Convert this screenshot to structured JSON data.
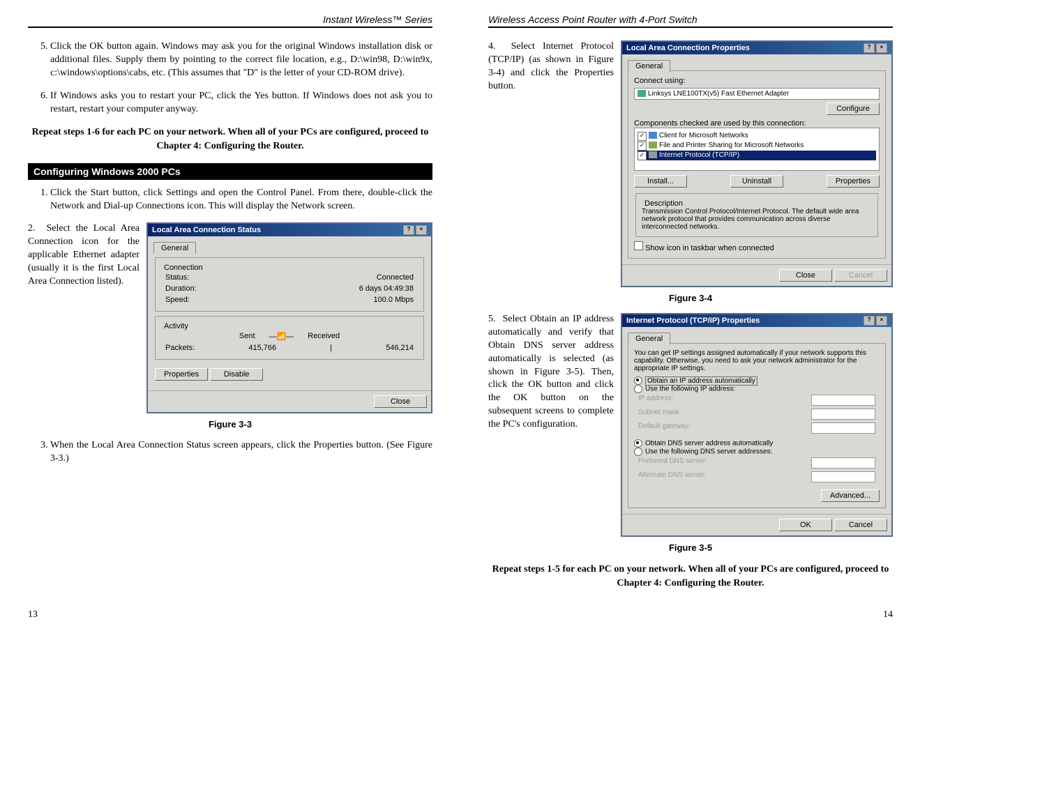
{
  "left": {
    "header": "Instant Wireless™ Series",
    "item5": "Click the OK button again.  Windows may ask you for the original Windows installation disk or additional files. Supply them by pointing to the correct file location, e.g., D:\\win98, D:\\win9x, c:\\windows\\options\\cabs, etc. (This assumes that \"D\" is the letter of your CD-ROM drive).",
    "item6": "If Windows asks you to restart your PC, click the  Yes button. If Windows does not ask you to restart, restart your computer anyway.",
    "repeat": "Repeat steps 1-6 for each PC on your network.  When all of your PCs are configured, proceed to Chapter 4: Configuring the Router.",
    "section": "Configuring Windows 2000 PCs",
    "s1": "Click the Start button, click Settings and open the Control Panel.  From there, double-click the Network and Dial-up Connections icon. This will display the Network screen.",
    "s2": "Select the  Local Area Connection icon for the applicable Ethernet adapter (usually it is the first Local Area Connection listed).",
    "s3": "When the Local Area Connection Status screen appears, click the Properties button. (See Figure 3-3.)",
    "fig33": {
      "title": "Local Area Connection Status",
      "tab": "General",
      "grp1": "Connection",
      "status_l": "Status:",
      "status_v": "Connected",
      "dur_l": "Duration:",
      "dur_v": "6 days 04:49:38",
      "spd_l": "Speed:",
      "spd_v": "100.0 Mbps",
      "grp2": "Activity",
      "sent": "Sent",
      "recv": "Received",
      "pkt_l": "Packets:",
      "pkt_s": "415,766",
      "pkt_r": "546,214",
      "props": "Properties",
      "disable": "Disable",
      "close": "Close"
    },
    "cap33": "Figure 3-3",
    "page": "13"
  },
  "right": {
    "header": "Wireless Access Point Router with 4-Port Switch",
    "s4": "Select Internet Protocol (TCP/IP) (as shown in Figure 3-4) and click the Properties button.",
    "s5": "Select Obtain an IP address automatically and verify that  Obtain DNS server address automatically is selected (as shown in Figure 3-5). Then, click the OK button and click the OK button on the subsequent screens to complete the PC's configuration.",
    "fig34": {
      "title": "Local Area Connection Properties",
      "tab": "General",
      "conn": "Connect using:",
      "adapter": "Linksys LNE100TX(v5) Fast Ethernet Adapter",
      "config": "Configure",
      "comp": "Components checked are used by this connection:",
      "c1": "Client for Microsoft Networks",
      "c2": "File and Printer Sharing for Microsoft Networks",
      "c3": "Internet Protocol (TCP/IP)",
      "install": "Install...",
      "uninstall": "Uninstall",
      "props": "Properties",
      "desc_l": "Description",
      "desc": "Transmission Control Protocol/Internet Protocol. The default wide area network protocol that provides communication across diverse interconnected networks.",
      "show": "Show icon in taskbar when connected",
      "close": "Close",
      "cancel": "Cancel"
    },
    "cap34": "Figure 3-4",
    "fig35": {
      "title": "Internet Protocol (TCP/IP) Properties",
      "tab": "General",
      "intro": "You can get IP settings assigned automatically if your network supports this capability. Otherwise, you need to ask your network administrator for the appropriate IP settings.",
      "r1": "Obtain an IP address automatically",
      "r2": "Use the following IP address:",
      "ip": "IP address:",
      "sn": "Subnet mask:",
      "gw": "Default gateway:",
      "r3": "Obtain DNS server address automatically",
      "r4": "Use the following DNS server addresses:",
      "pd": "Preferred DNS server:",
      "ad": "Alternate DNS server:",
      "adv": "Advanced...",
      "ok": "OK",
      "cancel": "Cancel"
    },
    "cap35": "Figure 3-5",
    "repeat": "Repeat steps 1-5 for each PC on your network.  When all of your PCs are configured, proceed to Chapter 4: Configuring the Router.",
    "page": "14"
  }
}
